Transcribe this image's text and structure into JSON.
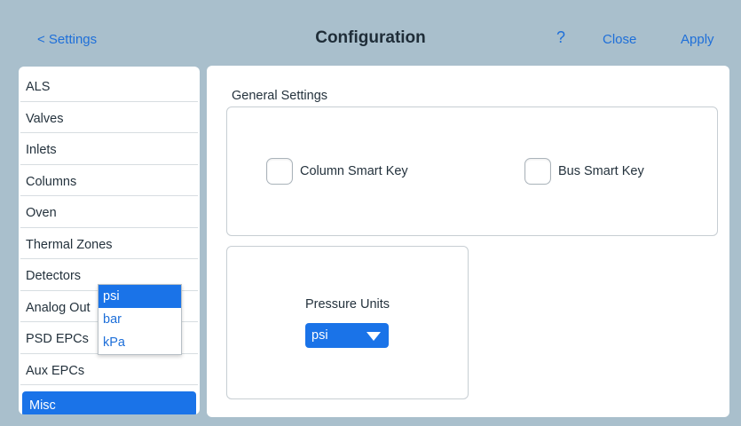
{
  "header": {
    "back_label": "< Settings",
    "title": "Configuration",
    "help_label": "?",
    "close_label": "Close",
    "apply_label": "Apply"
  },
  "sidebar": {
    "items": [
      {
        "label": "ALS"
      },
      {
        "label": "Valves"
      },
      {
        "label": "Inlets"
      },
      {
        "label": "Columns"
      },
      {
        "label": "Oven"
      },
      {
        "label": "Thermal Zones"
      },
      {
        "label": "Detectors"
      },
      {
        "label": "Analog Out"
      },
      {
        "label": "PSD EPCs"
      },
      {
        "label": "Aux EPCs"
      },
      {
        "label": "Misc",
        "active": true
      }
    ]
  },
  "general": {
    "section_label": "General Settings",
    "column_smart_key": {
      "label": "Column Smart Key",
      "checked": false
    },
    "bus_smart_key": {
      "label": "Bus Smart Key",
      "checked": false
    }
  },
  "pressure": {
    "label": "Pressure Units",
    "selected": "psi",
    "options": [
      "psi",
      "bar",
      "kPa"
    ]
  },
  "colors": {
    "accent": "#1a73e8",
    "background": "#a9bfcc"
  }
}
